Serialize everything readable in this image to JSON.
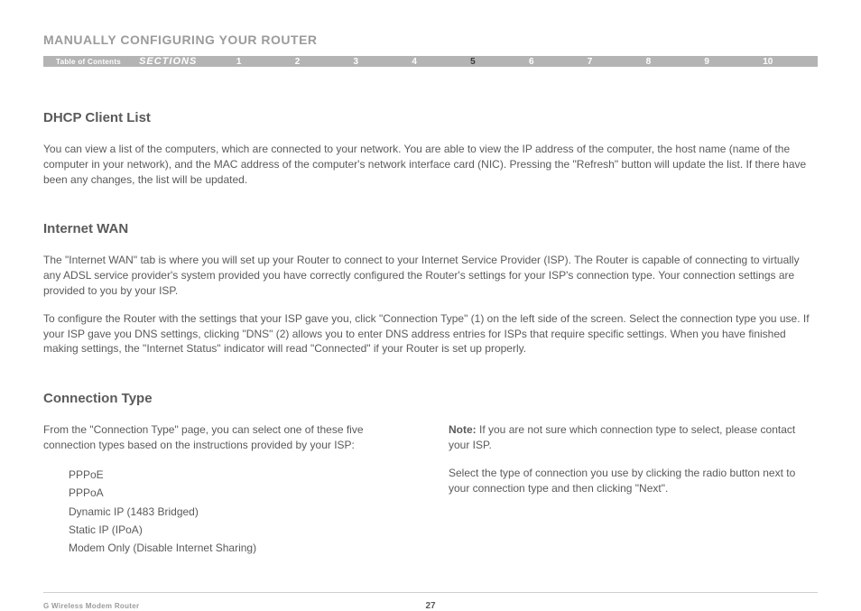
{
  "header": {
    "title": "MANUALLY CONFIGURING YOUR ROUTER"
  },
  "nav": {
    "toc": "Table of Contents",
    "sections_label": "SECTIONS",
    "items": [
      "1",
      "2",
      "3",
      "4",
      "5",
      "6",
      "7",
      "8",
      "9",
      "10"
    ],
    "active_index": 4
  },
  "sections": {
    "dhcp": {
      "heading": "DHCP Client List",
      "body": "You can view a list of the computers, which are connected to your network. You are able to view the IP address of the computer, the host name (name of the computer in your network), and the MAC address of the computer's network interface card (NIC). Pressing the \"Refresh\" button will update the list. If there have been any changes, the list will be updated."
    },
    "wan": {
      "heading": "Internet WAN",
      "p1": "The \"Internet WAN\" tab is where you will set up your Router to connect to your Internet Service Provider (ISP). The Router is capable of connecting to virtually any ADSL service provider's system provided you have correctly configured the Router's settings for your ISP's connection type. Your connection settings are provided to you by your ISP.",
      "p2": "To configure the Router with the settings that your ISP gave you, click \"Connection Type\" (1) on the left side of the screen. Select the connection type you use. If your ISP gave you DNS settings, clicking \"DNS\" (2) allows you to enter DNS address entries for ISPs that require specific settings. When you have finished making settings, the \"Internet Status\" indicator will read \"Connected\" if your Router is set up properly."
    },
    "conn": {
      "heading": "Connection Type",
      "intro": "From the \"Connection Type\" page, you can select one of these five connection types based on the instructions provided by your ISP:",
      "list": [
        "PPPoE",
        "PPPoA",
        "Dynamic IP (1483 Bridged)",
        "Static IP (IPoA)",
        "Modem Only (Disable Internet Sharing)"
      ],
      "note_label": "Note:",
      "note_body": " If you are not sure which connection type to select, please contact your ISP.",
      "select_body": "Select the type of connection you use by clicking the radio button next to your connection type and then clicking \"Next\"."
    }
  },
  "footer": {
    "product": "G Wireless Modem Router",
    "page": "27"
  }
}
